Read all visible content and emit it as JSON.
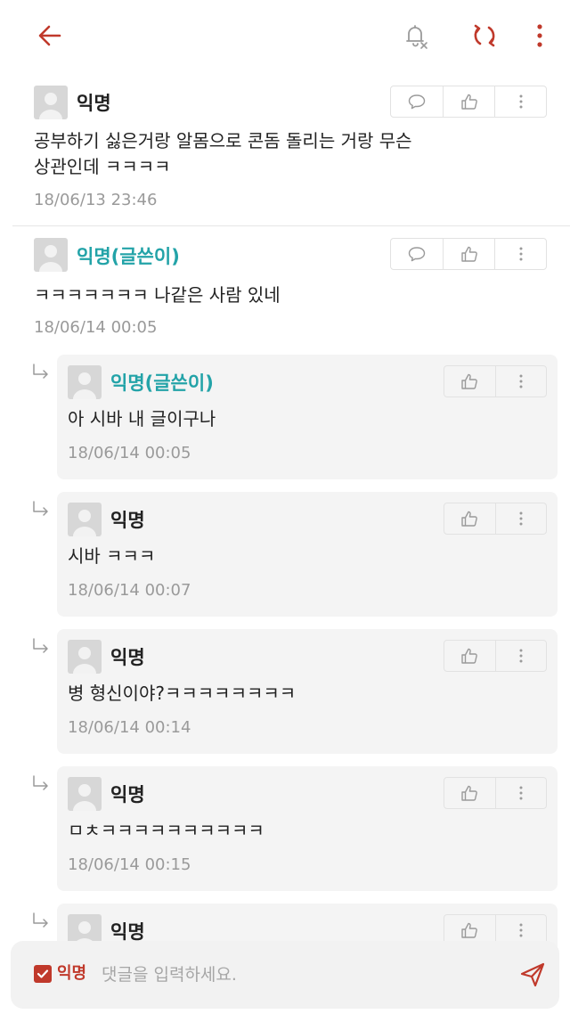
{
  "colors": {
    "accent": "#c0392b",
    "op_author": "#23a3a8",
    "timestamp": "#9a9a9a",
    "reply_bg": "#f4f4f4"
  },
  "header": {
    "icons": [
      "back-arrow-icon",
      "bell-off-icon",
      "refresh-icon",
      "more-vert-icon"
    ]
  },
  "comments": [
    {
      "author": "익명",
      "text": "공부하기 싫은거랑 알몸으로 콘돔 돌리는 거랑 무슨\n상관인데 ㅋㅋㅋㅋ",
      "time": "18/06/13 23:46"
    },
    {
      "author": "익명(글쓴이)",
      "text": "ㅋㅋㅋㅋㅋㅋㅋ 나같은 사람 있네",
      "time": "18/06/14 00:05",
      "replies": [
        {
          "author": "익명(글쓴이)",
          "text": "아 시바 내 글이구나",
          "time": "18/06/14 00:05"
        },
        {
          "author": "익명",
          "text": "시바 ㅋㅋㅋ",
          "time": "18/06/14 00:07"
        },
        {
          "author": "익명",
          "text": "병 형신이야?ㅋㅋㅋㅋㅋㅋㅋㅋ",
          "time": "18/06/14 00:14"
        },
        {
          "author": "익명",
          "text": "ㅁㅊㅋㅋㅋㅋㅋㅋㅋㅋㅋㅋ",
          "time": "18/06/14 00:15"
        },
        {
          "author": "익명",
          "text": "",
          "time": ""
        }
      ]
    }
  ],
  "composer": {
    "anonymous_label": "익명",
    "anonymous_checked": true,
    "placeholder": "댓글을 입력하세요.",
    "value": ""
  }
}
